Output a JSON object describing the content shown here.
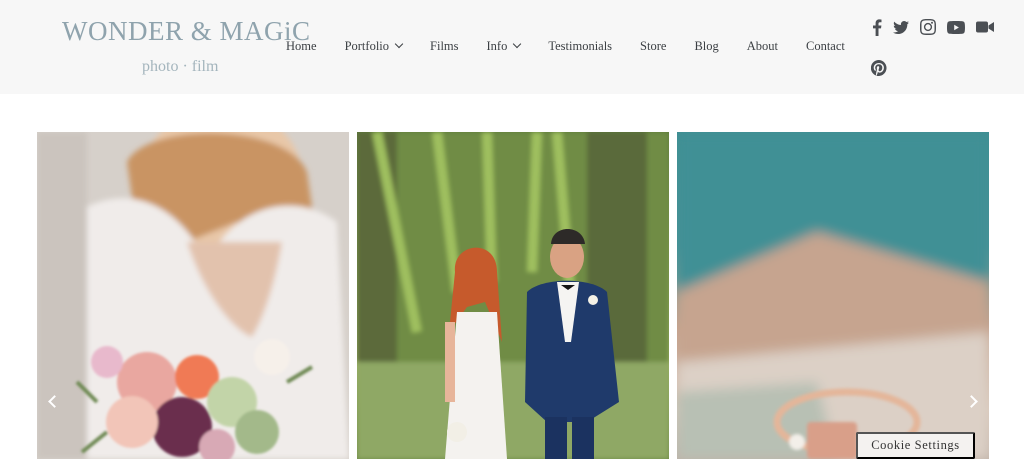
{
  "brand": {
    "logo_main": "WONDER & MAGiC",
    "logo_sub": "photo · film"
  },
  "nav": {
    "items": [
      {
        "label": "Home",
        "has_dropdown": false
      },
      {
        "label": "Portfolio",
        "has_dropdown": true
      },
      {
        "label": "Films",
        "has_dropdown": false
      },
      {
        "label": "Info",
        "has_dropdown": true
      },
      {
        "label": "Testimonials",
        "has_dropdown": false
      },
      {
        "label": "Store",
        "has_dropdown": false
      },
      {
        "label": "Blog",
        "has_dropdown": false
      },
      {
        "label": "About",
        "has_dropdown": false
      },
      {
        "label": "Contact",
        "has_dropdown": false
      }
    ]
  },
  "social": {
    "icons": [
      "facebook-icon",
      "twitter-icon",
      "instagram-icon",
      "youtube-icon",
      "vimeo-camera-icon",
      "pinterest-icon"
    ],
    "color": "#4b4f54"
  },
  "gallery": {
    "photos": [
      {
        "subject": "bride-bouquet"
      },
      {
        "subject": "couple-walking"
      },
      {
        "subject": "ring-detail"
      }
    ]
  },
  "cookie": {
    "label": "Cookie Settings"
  },
  "colors": {
    "header_bg": "#f7f7f7",
    "logo": "#8fa3ad",
    "nav_text": "#3b3f43"
  }
}
